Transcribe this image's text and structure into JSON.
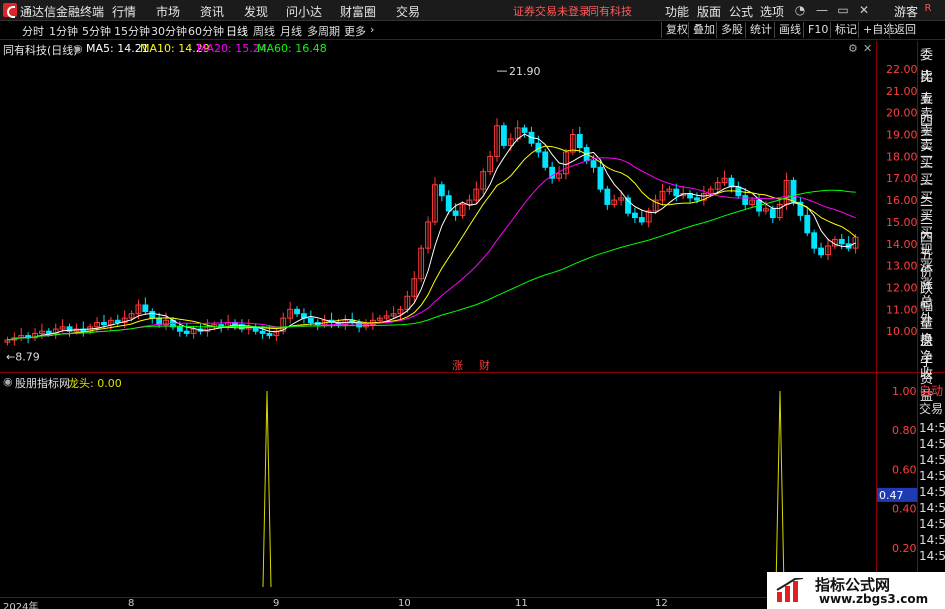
{
  "menubar": {
    "app_title": "通达信金融终端",
    "items": [
      "行情",
      "市场",
      "资讯",
      "发现",
      "问小达",
      "财富圈",
      "交易"
    ],
    "notice_left": "证券交易未登录",
    "notice_right": "同有科技",
    "right_items": [
      "功能",
      "版面",
      "公式",
      "选项"
    ],
    "user": "游客"
  },
  "periodbar": {
    "periods": [
      "分时",
      "1分钟",
      "5分钟",
      "15分钟",
      "30分钟",
      "60分钟",
      "日线",
      "周线",
      "月线",
      "多周期",
      "更多"
    ],
    "active": "日线",
    "tools": [
      "复权",
      "叠加",
      "多股",
      "统计",
      "画线",
      "F10",
      "标记",
      "+自选",
      "返回"
    ],
    "side_label": "R"
  },
  "main_header": {
    "stock": "同有科技(日线)",
    "ma5": "MA5: 14.21",
    "ma10": "MA10: 14.29",
    "ma20": "MA20: 15.24",
    "ma60": "MA60: 16.48",
    "colors": {
      "ma5": "#ffffff",
      "ma10": "#ffff00",
      "ma20": "#ff00ff",
      "ma60": "#00ff00"
    }
  },
  "right_panel": [
    "委比",
    "卖五",
    "卖四",
    "卖三",
    "卖二",
    "卖一",
    "买一",
    "买二",
    "买三",
    "买四",
    "买五",
    "现价",
    "涨跌",
    "涨幅",
    "总量",
    "外盘",
    "换手",
    "净资",
    "收益"
  ],
  "price_axis": [
    "22.00",
    "21.00",
    "20.00",
    "19.00",
    "18.00",
    "17.00",
    "16.00",
    "15.00",
    "14.00",
    "13.00",
    "12.00",
    "11.00",
    "10.00"
  ],
  "annotations": {
    "high": "21.90",
    "low": "8.79",
    "marker_up": "涨",
    "marker_fin": "财"
  },
  "sub_header": {
    "name": "股朋指标网",
    "label": "龙头: 0.00"
  },
  "sub_axis": [
    "1.00",
    "0.80",
    "0.60",
    "0.47",
    "0.40",
    "0.20"
  ],
  "sub_right": [
    "自动",
    "交易",
    "14:56",
    "14:56",
    "14:56",
    "14:56",
    "14:56",
    "14:56",
    "14:56",
    "14:56",
    "14:56"
  ],
  "x_axis": [
    "2024年",
    "8",
    "9",
    "10",
    "11",
    "12"
  ],
  "watermark": {
    "line1": "指标公式网",
    "line2": "www.zbgs3.com"
  },
  "chart_data": {
    "type": "candlestick",
    "price_range": [
      8.5,
      22.5
    ],
    "closes": [
      9.6,
      9.7,
      9.8,
      9.7,
      9.9,
      10.0,
      9.9,
      10.1,
      10.2,
      10.0,
      10.1,
      10.0,
      10.2,
      10.4,
      10.3,
      10.5,
      10.4,
      10.6,
      10.8,
      11.2,
      10.9,
      10.6,
      10.3,
      10.5,
      10.2,
      10.0,
      9.9,
      10.1,
      10.0,
      10.2,
      10.3,
      10.2,
      10.4,
      10.3,
      10.1,
      10.2,
      10.0,
      9.9,
      9.8,
      10.0,
      10.6,
      11.0,
      10.8,
      10.6,
      10.4,
      10.3,
      10.5,
      10.4,
      10.3,
      10.5,
      10.4,
      10.2,
      10.3,
      10.5,
      10.6,
      10.7,
      10.8,
      11.0,
      11.6,
      12.4,
      13.8,
      15.0,
      16.7,
      16.2,
      15.5,
      15.3,
      15.8,
      16.0,
      16.5,
      17.3,
      18.0,
      19.4,
      18.5,
      18.8,
      19.3,
      19.1,
      18.6,
      18.2,
      17.5,
      17.0,
      17.2,
      18.2,
      19.0,
      18.4,
      17.8,
      17.5,
      16.5,
      15.8,
      16.0,
      16.1,
      15.4,
      15.2,
      15.0,
      15.5,
      16.0,
      16.4,
      16.5,
      16.2,
      16.3,
      16.1,
      16.0,
      16.3,
      16.5,
      16.8,
      17.0,
      16.6,
      16.2,
      15.8,
      16.0,
      15.5,
      15.6,
      15.2,
      15.8,
      16.9,
      15.9,
      15.3,
      14.5,
      13.8,
      13.5,
      13.9,
      14.2,
      14.0,
      13.8,
      14.3
    ]
  }
}
